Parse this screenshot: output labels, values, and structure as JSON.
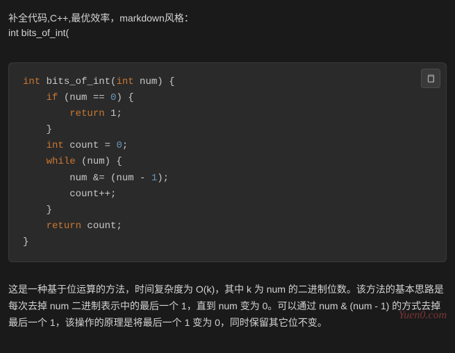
{
  "header": {
    "prompt_line1": "补全代码,C++,最优效率，markdown风格：",
    "prompt_line2": "int bits_of_int("
  },
  "code": {
    "l1_kw": "int",
    "l1_rest": " bits_of_int(",
    "l1_kw2": "int",
    "l1_rest2": " num) {",
    "l2_indent": "    ",
    "l2_kw": "if",
    "l2_rest": " (num == ",
    "l2_num": "0",
    "l2_rest2": ") {",
    "l3_indent": "        ",
    "l3_kw": "return",
    "l3_rest": " 1;",
    "l4": "    }",
    "l5_indent": "    ",
    "l5_kw": "int",
    "l5_rest": " count = ",
    "l5_num": "0",
    "l5_rest2": ";",
    "l6_indent": "    ",
    "l6_kw": "while",
    "l6_rest": " (num) {",
    "l7_indent": "        ",
    "l7_rest": "num &= (num - ",
    "l7_num": "1",
    "l7_rest2": ");",
    "l8": "        count++;",
    "l9": "    }",
    "l10_indent": "    ",
    "l10_kw": "return",
    "l10_rest": " count;",
    "l11": "}"
  },
  "explanation": {
    "text": "这是一种基于位运算的方法，时间复杂度为 O(k)，其中 k 为 num 的二进制位数。该方法的基本思路是每次去掉 num 二进制表示中的最后一个 1，直到 num 变为 0。可以通过 num & (num - 1) 的方式去掉最后一个 1，该操作的原理是将最后一个 1 变为 0，同时保留其它位不变。"
  },
  "watermark": "Yuen0.com"
}
